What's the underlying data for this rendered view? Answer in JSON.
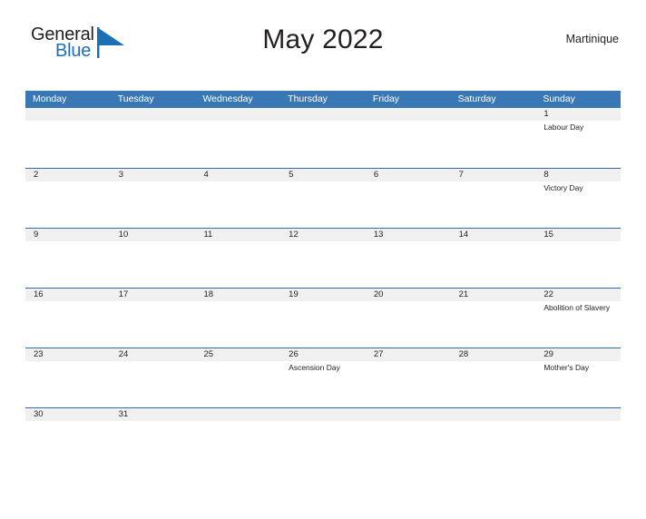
{
  "brand": {
    "name_part1": "General",
    "name_part2": "Blue",
    "flag_icon": "blue-flag-triangle-icon",
    "color_primary": "#1c6fb5",
    "color_text": "#231f20"
  },
  "header": {
    "title": "May 2022",
    "region": "Martinique"
  },
  "calendar": {
    "header_bg": "#3a78b5",
    "rule_color": "#2f6ea8",
    "daynum_bg": "#f0f0f0",
    "weekdays": [
      "Monday",
      "Tuesday",
      "Wednesday",
      "Thursday",
      "Friday",
      "Saturday",
      "Sunday"
    ],
    "weeks": [
      {
        "days": [
          {
            "num": "",
            "event": ""
          },
          {
            "num": "",
            "event": ""
          },
          {
            "num": "",
            "event": ""
          },
          {
            "num": "",
            "event": ""
          },
          {
            "num": "",
            "event": ""
          },
          {
            "num": "",
            "event": ""
          },
          {
            "num": "1",
            "event": "Labour Day"
          }
        ]
      },
      {
        "days": [
          {
            "num": "2",
            "event": ""
          },
          {
            "num": "3",
            "event": ""
          },
          {
            "num": "4",
            "event": ""
          },
          {
            "num": "5",
            "event": ""
          },
          {
            "num": "6",
            "event": ""
          },
          {
            "num": "7",
            "event": ""
          },
          {
            "num": "8",
            "event": "Victory Day"
          }
        ]
      },
      {
        "days": [
          {
            "num": "9",
            "event": ""
          },
          {
            "num": "10",
            "event": ""
          },
          {
            "num": "11",
            "event": ""
          },
          {
            "num": "12",
            "event": ""
          },
          {
            "num": "13",
            "event": ""
          },
          {
            "num": "14",
            "event": ""
          },
          {
            "num": "15",
            "event": ""
          }
        ]
      },
      {
        "days": [
          {
            "num": "16",
            "event": ""
          },
          {
            "num": "17",
            "event": ""
          },
          {
            "num": "18",
            "event": ""
          },
          {
            "num": "19",
            "event": ""
          },
          {
            "num": "20",
            "event": ""
          },
          {
            "num": "21",
            "event": ""
          },
          {
            "num": "22",
            "event": "Abolition of Slavery"
          }
        ]
      },
      {
        "days": [
          {
            "num": "23",
            "event": ""
          },
          {
            "num": "24",
            "event": ""
          },
          {
            "num": "25",
            "event": ""
          },
          {
            "num": "26",
            "event": "Ascension Day"
          },
          {
            "num": "27",
            "event": ""
          },
          {
            "num": "28",
            "event": ""
          },
          {
            "num": "29",
            "event": "Mother's Day"
          }
        ]
      },
      {
        "days": [
          {
            "num": "30",
            "event": ""
          },
          {
            "num": "31",
            "event": ""
          },
          {
            "num": "",
            "event": ""
          },
          {
            "num": "",
            "event": ""
          },
          {
            "num": "",
            "event": ""
          },
          {
            "num": "",
            "event": ""
          },
          {
            "num": "",
            "event": ""
          }
        ]
      }
    ]
  }
}
